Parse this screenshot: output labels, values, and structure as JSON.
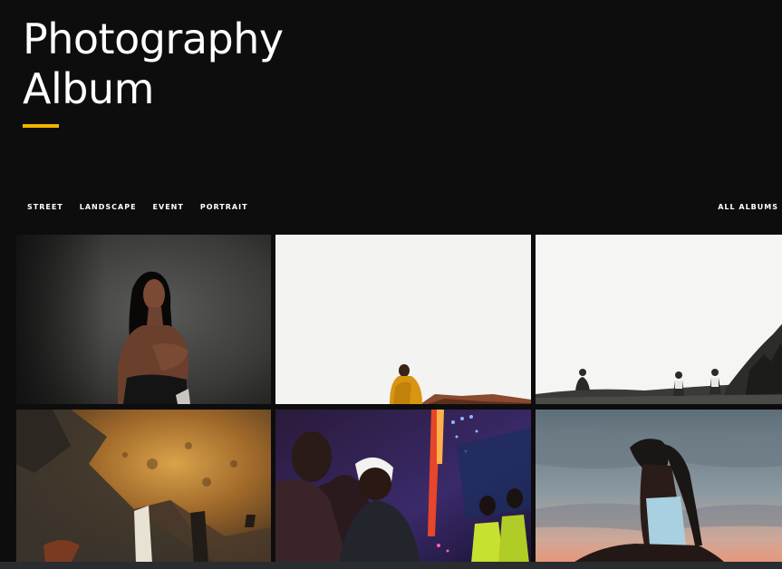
{
  "header": {
    "title_line1": "Photography",
    "title_line2": "Album",
    "accent_color": "#f2b400"
  },
  "nav": {
    "categories": [
      "STREET",
      "LANDSCAPE",
      "EVENT",
      "PORTRAIT"
    ],
    "all_albums": "ALL ALBUMS"
  },
  "gallery": {
    "photos": [
      {
        "subject": "portrait-woman-dark-background"
      },
      {
        "subject": "person-in-yellow-on-white-sky"
      },
      {
        "subject": "people-on-rocky-hill"
      },
      {
        "subject": "rusted-wall-shadows"
      },
      {
        "subject": "concert-crowd-lights"
      },
      {
        "subject": "woman-against-sunset-sky"
      }
    ]
  }
}
